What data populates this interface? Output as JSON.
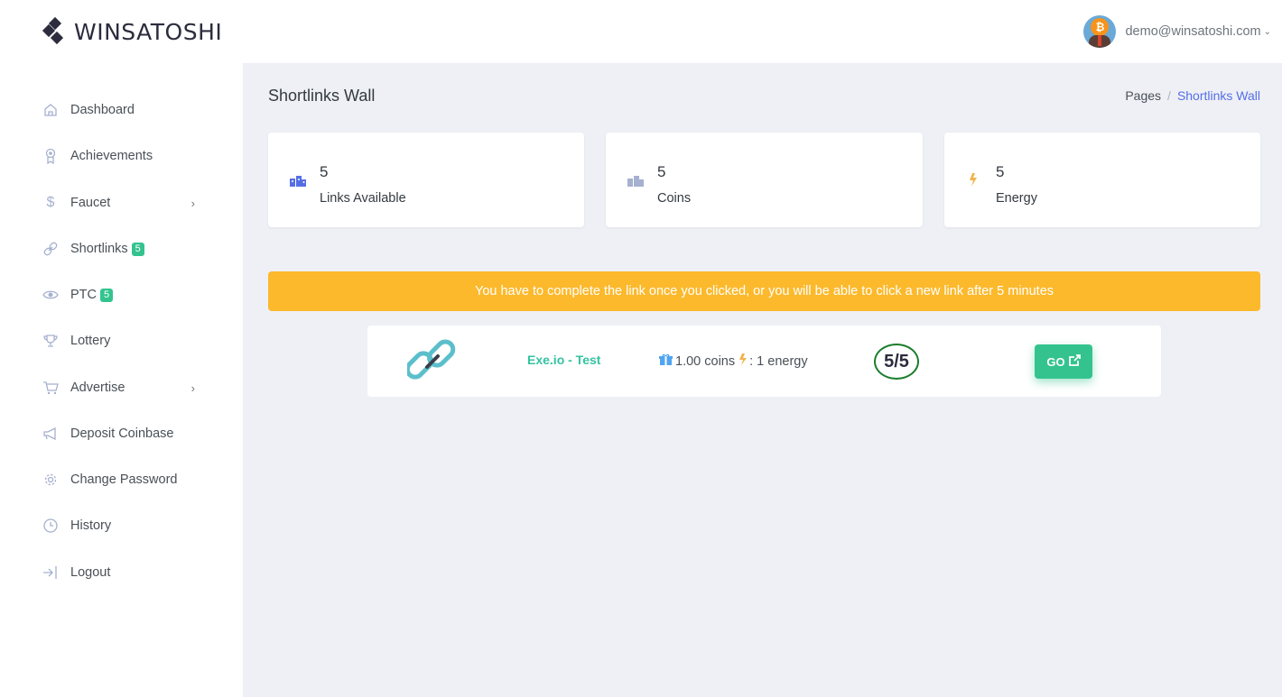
{
  "header": {
    "logo_text": "WINSATOSHI",
    "user_email": "demo@winsatoshi.com",
    "avatar_icon": "bitcoin-avatar-icon"
  },
  "sidebar": {
    "items": [
      {
        "label": "Dashboard",
        "icon": "home-icon"
      },
      {
        "label": "Achievements",
        "icon": "medal-icon"
      },
      {
        "label": "Faucet",
        "icon": "dollar-icon",
        "has_submenu": true
      },
      {
        "label": "Shortlinks",
        "icon": "link-icon",
        "badge": "5"
      },
      {
        "label": "PTC",
        "icon": "eye-icon",
        "badge": "5"
      },
      {
        "label": "Lottery",
        "icon": "trophy-icon"
      },
      {
        "label": "Advertise",
        "icon": "cart-icon",
        "has_submenu": true
      },
      {
        "label": "Deposit Coinbase",
        "icon": "megaphone-icon"
      },
      {
        "label": "Change Password",
        "icon": "gear-icon"
      },
      {
        "label": "History",
        "icon": "clock-icon"
      },
      {
        "label": "Logout",
        "icon": "logout-icon"
      }
    ]
  },
  "page": {
    "title": "Shortlinks Wall",
    "breadcrumb": [
      "Pages",
      "Shortlinks Wall"
    ]
  },
  "stats": [
    {
      "value": "5",
      "label": "Links Available",
      "icon": "coins-icon",
      "icon_color": "#556ee6"
    },
    {
      "value": "5",
      "label": "Coins",
      "icon": "coins-icon",
      "icon_color": "#a6b0cf"
    },
    {
      "value": "5",
      "label": "Energy",
      "icon": "bolt-icon",
      "icon_color": "#f1b44c"
    }
  ],
  "alert": {
    "text": "You have to complete the link once you clicked, or you will be able to click a new link after 5 minutes",
    "color": "#fcb92c"
  },
  "links": [
    {
      "name": "Exe.io - Test",
      "coins": "1.00 coins",
      "energy": ": 1 energy",
      "count": "5/5",
      "button": "GO"
    }
  ],
  "colors": {
    "accent": "#556ee6",
    "success": "#34c38f",
    "warning": "#fcb92c"
  }
}
